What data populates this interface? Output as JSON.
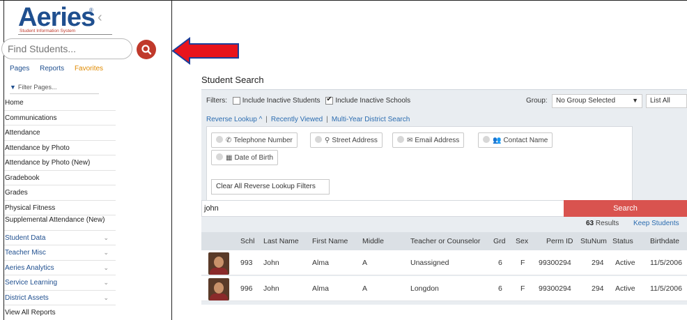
{
  "logo": {
    "name": "Aeries",
    "reg": "®",
    "subtitle": "Student Information System"
  },
  "search": {
    "placeholder": "Find Students..."
  },
  "nav_tabs": {
    "pages": "Pages",
    "reports": "Reports",
    "favorites": "Favorites"
  },
  "filter_pages": "Filter Pages...",
  "menu": [
    "Home",
    "Communications",
    "Attendance",
    "Attendance by Photo",
    "Attendance by Photo (New)",
    "Gradebook",
    "Grades",
    "Physical Fitness",
    "Supplemental Attendance (New)",
    "Student Data",
    "Teacher Misc",
    "Aeries Analytics",
    "Service Learning",
    "District Assets",
    "View All Reports"
  ],
  "student_search": {
    "title": "Student Search",
    "filters_label": "Filters:",
    "include_inactive_students": "Include Inactive Students",
    "include_inactive_schools": "Include Inactive Schools",
    "group_label": "Group:",
    "group_value": "No Group Selected",
    "list_all": "List All",
    "links": {
      "reverse_lookup": "Reverse Lookup ^",
      "recently_viewed": "Recently Viewed",
      "multi_year": "Multi-Year District Search"
    },
    "reverse_lookup_options": {
      "telephone": "Telephone Number",
      "street": "Street Address",
      "email": "Email Address",
      "contact": "Contact Name",
      "dob": "Date of Birth"
    },
    "clear_filters": "Clear All Reverse Lookup Filters",
    "query": "john",
    "search_button": "Search",
    "results_count": "63",
    "results_label": "Results",
    "keep_students": "Keep Students",
    "columns": {
      "schl": "Schl",
      "last": "Last Name",
      "first": "First Name",
      "middle": "Middle",
      "teacher": "Teacher or Counselor",
      "grd": "Grd",
      "sex": "Sex",
      "perm": "Perm ID",
      "stunum": "StuNum",
      "status": "Status",
      "birthdate": "Birthdate"
    },
    "rows": [
      {
        "schl": "993",
        "last": "John",
        "first": "Alma",
        "middle": "A",
        "teacher": "Unassigned",
        "grd": "6",
        "sex": "F",
        "perm": "99300294",
        "stunum": "294",
        "status": "Active",
        "birthdate": "11/5/2006"
      },
      {
        "schl": "996",
        "last": "John",
        "first": "Alma",
        "middle": "A",
        "teacher": "Longdon",
        "grd": "6",
        "sex": "F",
        "perm": "99300294",
        "stunum": "294",
        "status": "Active",
        "birthdate": "11/5/2006"
      }
    ]
  },
  "colors": {
    "brand": "#1f4f8f",
    "accent": "#c0392b",
    "search_button": "#d9534f",
    "link": "#2b6cb0",
    "favorites": "#e08a00"
  }
}
